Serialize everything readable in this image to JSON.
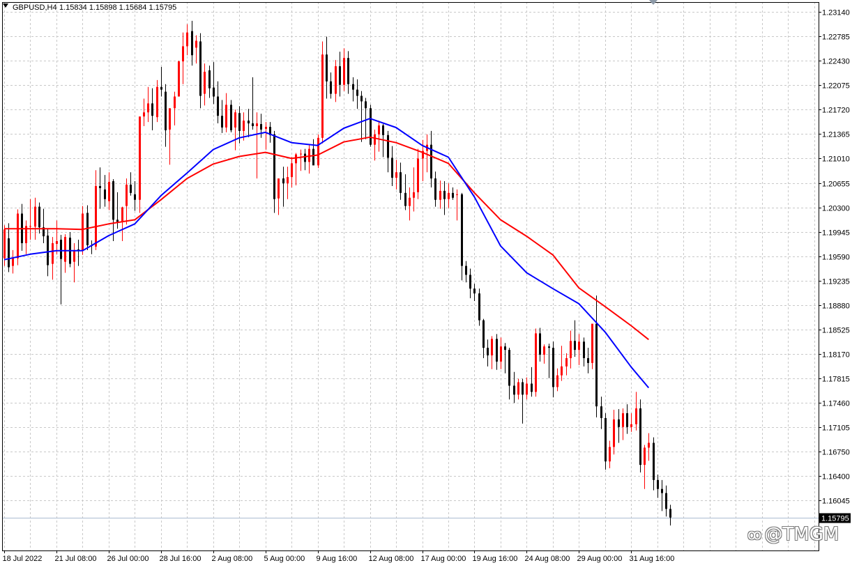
{
  "header": {
    "symbol_label": "GBPUSD,H4",
    "ohlc_label": "1.15834 1.15898 1.15684 1.15795"
  },
  "price_axis": {
    "ticks": [
      1.2314,
      1.22785,
      1.2243,
      1.22075,
      1.2172,
      1.21365,
      1.2101,
      1.20655,
      1.203,
      1.19945,
      1.1959,
      1.19235,
      1.1888,
      1.18525,
      1.1817,
      1.17815,
      1.1746,
      1.17105,
      1.1675,
      1.164,
      1.16045
    ],
    "tick_labels": [
      "1.23140",
      "1.22785",
      "1.22430",
      "1.22075",
      "1.21720",
      "1.21365",
      "1.21010",
      "1.20655",
      "1.20300",
      "1.19945",
      "1.19590",
      "1.19235",
      "1.18880",
      "1.18525",
      "1.18170",
      "1.17815",
      "1.17460",
      "1.17105",
      "1.16750",
      "1.16400",
      "1.16045"
    ],
    "current_price": 1.15795,
    "current_price_label": "1.15795"
  },
  "time_axis": {
    "labels": [
      "18 Jul 2022",
      "21 Jul 08:00",
      "26 Jul 00:00",
      "28 Jul 16:00",
      "2 Aug 08:00",
      "5 Aug 00:00",
      "9 Aug 16:00",
      "12 Aug 08:00",
      "17 Aug 00:00",
      "19 Aug 16:00",
      "24 Aug 08:00",
      "29 Aug 00:00",
      "31 Aug 16:00"
    ]
  },
  "watermark": {
    "symbol": "ꝏ",
    "text": "@TMGM"
  },
  "colors": {
    "bull": "#ff0000",
    "bear": "#000000",
    "ma_fast": "#0000ff",
    "ma_slow": "#ff0000",
    "grid": "#c8c8c8",
    "current_line": "#aabbd0"
  },
  "chart_data": {
    "type": "candlestick",
    "symbol": "GBPUSD",
    "timeframe": "H4",
    "ylim": [
      1.1565,
      1.2323
    ],
    "x_label_bar_index": [
      0,
      12,
      24,
      36,
      48,
      60,
      72,
      84,
      96,
      108,
      120,
      132,
      144
    ],
    "candles": [
      [
        1.1956,
        1.2004,
        1.1945,
        1.1998
      ],
      [
        1.1985,
        1.2007,
        1.1936,
        1.1943
      ],
      [
        1.1945,
        1.1968,
        1.1934,
        1.1956
      ],
      [
        1.1956,
        1.2027,
        1.1946,
        1.2021
      ],
      [
        1.2021,
        1.2035,
        1.1967,
        1.1978
      ],
      [
        1.1978,
        1.2011,
        1.1962,
        1.2003
      ],
      [
        1.2002,
        1.2042,
        1.1983,
        1.2003
      ],
      [
        1.2002,
        1.2044,
        1.1983,
        1.2031
      ],
      [
        1.2031,
        1.2037,
        1.1992,
        1.2001
      ],
      [
        1.2001,
        1.2028,
        1.1978,
        1.1988
      ],
      [
        1.1989,
        1.1999,
        1.193,
        1.1946
      ],
      [
        1.1948,
        1.1987,
        1.1925,
        1.1978
      ],
      [
        1.1977,
        1.2011,
        1.1962,
        1.1981
      ],
      [
        1.1983,
        1.199,
        1.1889,
        1.1955
      ],
      [
        1.1951,
        1.1991,
        1.1935,
        1.1987
      ],
      [
        1.1986,
        1.1994,
        1.1943,
        1.1948
      ],
      [
        1.1951,
        1.1978,
        1.1921,
        1.1968
      ],
      [
        1.1969,
        1.1983,
        1.1945,
        1.1967
      ],
      [
        1.1967,
        1.2032,
        1.1961,
        1.2021
      ],
      [
        1.2022,
        1.2033,
        1.1968,
        1.1975
      ],
      [
        1.1975,
        1.1982,
        1.1962,
        1.1974
      ],
      [
        1.1973,
        1.2084,
        1.1968,
        1.2061
      ],
      [
        1.2061,
        1.2088,
        1.2028,
        1.2058
      ],
      [
        1.2056,
        1.2077,
        1.2031,
        1.2042
      ],
      [
        1.2039,
        1.2081,
        1.2026,
        1.2067
      ],
      [
        1.2068,
        1.2071,
        1.1981,
        1.2012
      ],
      [
        1.2012,
        1.2052,
        1.1999,
        1.2009
      ],
      [
        1.2009,
        1.2031,
        1.1981,
        1.203
      ],
      [
        1.2032,
        1.2072,
        1.2005,
        1.2063
      ],
      [
        1.2063,
        1.2081,
        1.2047,
        1.2051
      ],
      [
        1.2049,
        1.2068,
        1.2025,
        1.2041
      ],
      [
        1.2041,
        1.2102,
        1.2022,
        1.2162
      ],
      [
        1.2162,
        1.2188,
        1.2148,
        1.2168
      ],
      [
        1.2168,
        1.2205,
        1.2154,
        1.2181
      ],
      [
        1.2181,
        1.2203,
        1.2142,
        1.2163
      ],
      [
        1.2161,
        1.2215,
        1.2154,
        1.2205
      ],
      [
        1.2205,
        1.2234,
        1.2191,
        1.2201
      ],
      [
        1.2198,
        1.2209,
        1.2118,
        1.2142
      ],
      [
        1.2143,
        1.2172,
        1.2092,
        1.2174
      ],
      [
        1.2174,
        1.2198,
        1.2149,
        1.2191
      ],
      [
        1.2191,
        1.2243,
        1.2193,
        1.2242
      ],
      [
        1.2242,
        1.2284,
        1.2209,
        1.2264
      ],
      [
        1.2264,
        1.2296,
        1.2251,
        1.2284
      ],
      [
        1.2286,
        1.2301,
        1.2236,
        1.2251
      ],
      [
        1.2262,
        1.228,
        1.2239,
        1.2272
      ],
      [
        1.2271,
        1.2283,
        1.2174,
        1.2192
      ],
      [
        1.2195,
        1.2239,
        1.2178,
        1.2227
      ],
      [
        1.2229,
        1.2236,
        1.2189,
        1.2203
      ],
      [
        1.2204,
        1.2241,
        1.218,
        1.2191
      ],
      [
        1.2191,
        1.2213,
        1.2152,
        1.2163
      ],
      [
        1.2163,
        1.2186,
        1.2138,
        1.2146
      ],
      [
        1.2146,
        1.2196,
        1.2139,
        1.2179
      ],
      [
        1.2179,
        1.2186,
        1.2139,
        1.2142
      ],
      [
        1.2146,
        1.2172,
        1.2113,
        1.2168
      ],
      [
        1.2167,
        1.2177,
        1.2123,
        1.2141
      ],
      [
        1.2141,
        1.2168,
        1.2127,
        1.2156
      ],
      [
        1.2156,
        1.2173,
        1.2132,
        1.2152
      ],
      [
        1.2152,
        1.2219,
        1.2143,
        1.2148
      ],
      [
        1.2148,
        1.2168,
        1.2072,
        1.2152
      ],
      [
        1.2151,
        1.2166,
        1.2131,
        1.2143
      ],
      [
        1.2144,
        1.2154,
        1.2114,
        1.2147
      ],
      [
        1.2147,
        1.2154,
        1.2124,
        1.2135
      ],
      [
        1.2136,
        1.2141,
        1.2022,
        1.2042
      ],
      [
        1.2043,
        1.2061,
        1.2019,
        1.2072
      ],
      [
        1.2072,
        1.2089,
        1.2031,
        1.2065
      ],
      [
        1.2065,
        1.2089,
        1.2042,
        1.2074
      ],
      [
        1.2074,
        1.2103,
        1.2059,
        1.2094
      ],
      [
        1.2094,
        1.2109,
        1.2062,
        1.2107
      ],
      [
        1.2107,
        1.2114,
        1.2083,
        1.2108
      ],
      [
        1.2108,
        1.2115,
        1.2084,
        1.2096
      ],
      [
        1.2096,
        1.2122,
        1.2079,
        1.2115
      ],
      [
        1.2115,
        1.2129,
        1.2093,
        1.2091
      ],
      [
        1.2091,
        1.2136,
        1.2087,
        1.2131
      ],
      [
        1.2131,
        1.2271,
        1.2123,
        1.2252
      ],
      [
        1.2252,
        1.2278,
        1.2188,
        1.2213
      ],
      [
        1.2213,
        1.2226,
        1.2188,
        1.2195
      ],
      [
        1.2195,
        1.2244,
        1.2183,
        1.2235
      ],
      [
        1.2235,
        1.2256,
        1.2191,
        1.2208
      ],
      [
        1.2208,
        1.2261,
        1.2199,
        1.2247
      ],
      [
        1.2247,
        1.2257,
        1.2195,
        1.2209
      ],
      [
        1.2209,
        1.2219,
        1.2184,
        1.2201
      ],
      [
        1.2201,
        1.2216,
        1.2173,
        1.2192
      ],
      [
        1.2192,
        1.2199,
        1.2125,
        1.2184
      ],
      [
        1.2184,
        1.2189,
        1.2129,
        1.2174
      ],
      [
        1.2174,
        1.2179,
        1.2118,
        1.2121
      ],
      [
        1.2121,
        1.2143,
        1.2098,
        1.2136
      ],
      [
        1.2136,
        1.2156,
        1.2111,
        1.2149
      ],
      [
        1.2149,
        1.2151,
        1.2103,
        1.2135
      ],
      [
        1.2135,
        1.2141,
        1.2081,
        1.2102
      ],
      [
        1.2102,
        1.2119,
        1.2061,
        1.2073
      ],
      [
        1.2073,
        1.2099,
        1.2056,
        1.2081
      ],
      [
        1.2081,
        1.2095,
        1.2041,
        1.2051
      ],
      [
        1.2051,
        1.2078,
        1.2026,
        1.2032
      ],
      [
        1.2032,
        1.2059,
        1.2011,
        1.2044
      ],
      [
        1.2044,
        1.2088,
        1.2024,
        1.2052
      ],
      [
        1.2052,
        1.2115,
        1.2042,
        1.2101
      ],
      [
        1.2101,
        1.2128,
        1.2068,
        1.2112
      ],
      [
        1.2112,
        1.2136,
        1.2081,
        1.2121
      ],
      [
        1.2121,
        1.2141,
        1.2059,
        1.2072
      ],
      [
        1.2072,
        1.2082,
        1.2031,
        1.2041
      ],
      [
        1.2041,
        1.2069,
        1.2028,
        1.2054
      ],
      [
        1.2054,
        1.2068,
        1.2019,
        1.2042
      ],
      [
        1.2042,
        1.2065,
        1.2029,
        1.2051
      ],
      [
        1.2051,
        1.2059,
        1.2041,
        1.2044
      ],
      [
        1.2048,
        1.2056,
        1.2011,
        1.2049
      ],
      [
        1.2049,
        1.2051,
        1.1924,
        1.1945
      ],
      [
        1.1945,
        1.1952,
        1.1921,
        1.1932
      ],
      [
        1.1932,
        1.1941,
        1.1898,
        1.1912
      ],
      [
        1.1912,
        1.1919,
        1.1894,
        1.1905
      ],
      [
        1.1905,
        1.1912,
        1.1858,
        1.1866
      ],
      [
        1.1866,
        1.1868,
        1.1811,
        1.1826
      ],
      [
        1.1826,
        1.1838,
        1.1799,
        1.1815
      ],
      [
        1.1815,
        1.1843,
        1.1795,
        1.1839
      ],
      [
        1.1839,
        1.1846,
        1.1794,
        1.1806
      ],
      [
        1.1806,
        1.1841,
        1.1795,
        1.1828
      ],
      [
        1.1828,
        1.1833,
        1.1789,
        1.1823
      ],
      [
        1.1823,
        1.1826,
        1.1751,
        1.1771
      ],
      [
        1.1771,
        1.1791,
        1.1746,
        1.1758
      ],
      [
        1.1758,
        1.1781,
        1.1751,
        1.1776
      ],
      [
        1.1776,
        1.1781,
        1.1716,
        1.1758
      ],
      [
        1.1758,
        1.1783,
        1.1751,
        1.1774
      ],
      [
        1.1774,
        1.1798,
        1.1755,
        1.1762
      ],
      [
        1.1762,
        1.1854,
        1.1755,
        1.1847
      ],
      [
        1.1847,
        1.1855,
        1.1806,
        1.1816
      ],
      [
        1.1816,
        1.1831,
        1.1803,
        1.1828
      ],
      [
        1.1828,
        1.1832,
        1.1782,
        1.1826
      ],
      [
        1.1826,
        1.1835,
        1.1754,
        1.1769
      ],
      [
        1.1769,
        1.1796,
        1.1763,
        1.1786
      ],
      [
        1.1786,
        1.1829,
        1.1778,
        1.1799
      ],
      [
        1.1799,
        1.1818,
        1.1786,
        1.1811
      ],
      [
        1.1811,
        1.1851,
        1.1796,
        1.1836
      ],
      [
        1.1836,
        1.1866,
        1.1813,
        1.1823
      ],
      [
        1.1823,
        1.1846,
        1.1801,
        1.1835
      ],
      [
        1.1835,
        1.1841,
        1.1799,
        1.1811
      ],
      [
        1.1811,
        1.1826,
        1.1789,
        1.1804
      ],
      [
        1.1804,
        1.1858,
        1.1795,
        1.1861
      ],
      [
        1.1861,
        1.1902,
        1.1725,
        1.1741
      ],
      [
        1.1741,
        1.1755,
        1.1708,
        1.1724
      ],
      [
        1.1724,
        1.1731,
        1.1649,
        1.1661
      ],
      [
        1.1661,
        1.1691,
        1.1651,
        1.1682
      ],
      [
        1.1682,
        1.1736,
        1.1671,
        1.1722
      ],
      [
        1.1722,
        1.1737,
        1.1688,
        1.1711
      ],
      [
        1.1711,
        1.1738,
        1.1692,
        1.1731
      ],
      [
        1.1731,
        1.1744,
        1.1701,
        1.1711
      ],
      [
        1.1711,
        1.1731,
        1.1704,
        1.1715
      ],
      [
        1.1715,
        1.1762,
        1.1706,
        1.1738
      ],
      [
        1.1738,
        1.1751,
        1.1645,
        1.1656
      ],
      [
        1.1656,
        1.1685,
        1.1621,
        1.1681
      ],
      [
        1.1681,
        1.1702,
        1.1662,
        1.1688
      ],
      [
        1.1688,
        1.1696,
        1.1619,
        1.1634
      ],
      [
        1.1634,
        1.1642,
        1.1608,
        1.1621
      ],
      [
        1.1621,
        1.1634,
        1.1589,
        1.1615
      ],
      [
        1.1615,
        1.1626,
        1.1581,
        1.1592
      ],
      [
        1.1592,
        1.1598,
        1.1568,
        1.15795
      ]
    ],
    "ma_fast": [
      [
        0,
        1.1954
      ],
      [
        6,
        1.1962
      ],
      [
        12,
        1.1967
      ],
      [
        18,
        1.1967
      ],
      [
        24,
        1.1989
      ],
      [
        30,
        1.2006
      ],
      [
        36,
        1.2047
      ],
      [
        42,
        1.208
      ],
      [
        48,
        1.2114
      ],
      [
        54,
        1.2131
      ],
      [
        60,
        1.2139
      ],
      [
        66,
        1.2124
      ],
      [
        72,
        1.212
      ],
      [
        78,
        1.2145
      ],
      [
        84,
        1.2159
      ],
      [
        90,
        1.2146
      ],
      [
        96,
        1.212
      ],
      [
        102,
        1.2103
      ],
      [
        108,
        1.2045
      ],
      [
        114,
        1.1974
      ],
      [
        120,
        1.1935
      ],
      [
        126,
        1.1912
      ],
      [
        132,
        1.189
      ],
      [
        138,
        1.1849
      ],
      [
        144,
        1.1798
      ],
      [
        148,
        1.1768
      ]
    ],
    "ma_slow": [
      [
        0,
        1.1999
      ],
      [
        6,
        1.1999
      ],
      [
        12,
        1.1999
      ],
      [
        18,
        1.1998
      ],
      [
        24,
        1.2006
      ],
      [
        30,
        1.2012
      ],
      [
        36,
        1.2041
      ],
      [
        42,
        1.2072
      ],
      [
        48,
        1.2093
      ],
      [
        54,
        1.2104
      ],
      [
        60,
        1.211
      ],
      [
        66,
        1.2101
      ],
      [
        72,
        1.2106
      ],
      [
        78,
        1.2125
      ],
      [
        84,
        1.2132
      ],
      [
        90,
        1.2124
      ],
      [
        96,
        1.211
      ],
      [
        102,
        1.2094
      ],
      [
        108,
        1.2051
      ],
      [
        114,
        1.2012
      ],
      [
        120,
        1.1988
      ],
      [
        126,
        1.1961
      ],
      [
        132,
        1.1913
      ],
      [
        138,
        1.1886
      ],
      [
        144,
        1.1858
      ],
      [
        148,
        1.1838
      ]
    ]
  }
}
